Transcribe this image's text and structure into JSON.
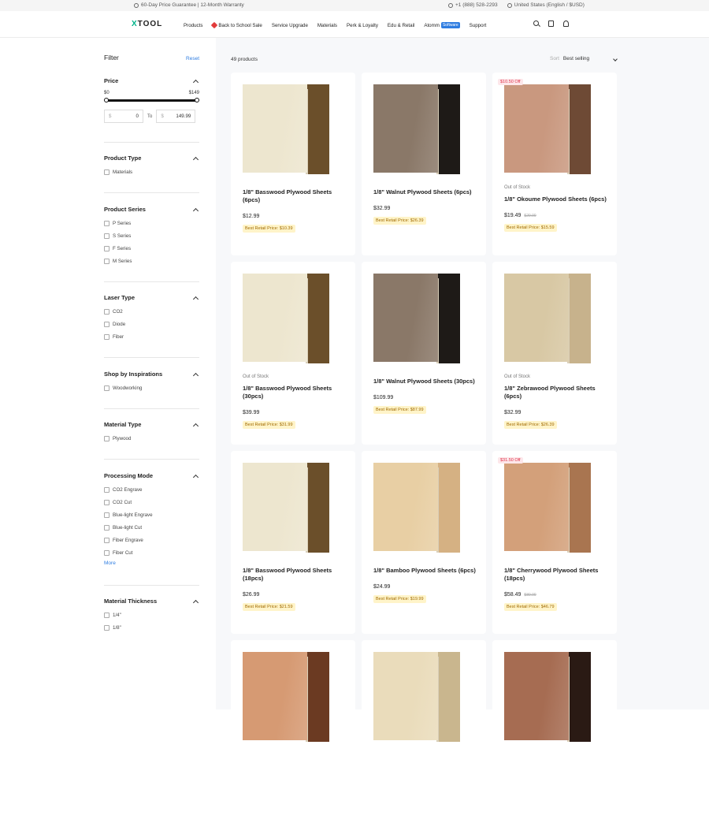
{
  "topbar": {
    "promo": "60-Day Price Guarantee | 12-Month Warranty",
    "phone": "+1 (888) 528-2293",
    "region": "United States (English / $USD)"
  },
  "nav": {
    "logo_prefix": "X",
    "logo_rest": "TOOL",
    "items": [
      "Products",
      "Back to School Sale",
      "Service Upgrade",
      "Materials",
      "Perk & Loyalty",
      "Edu & Retail",
      "Atomm",
      "Support"
    ],
    "atomm_badge": "Software",
    "icons": [
      "search-icon",
      "bag-icon",
      "user-icon"
    ]
  },
  "filter": {
    "title": "Filter",
    "reset": "Reset",
    "price": {
      "title": "Price",
      "min_label": "$0",
      "max_label": "$149",
      "currency": "$",
      "from_value": "0",
      "to_label": "To",
      "to_value": "149.99"
    },
    "product_type": {
      "title": "Product Type",
      "options": [
        "Materials"
      ]
    },
    "product_series": {
      "title": "Product Series",
      "options": [
        "P Series",
        "S Series",
        "F Series",
        "M Series"
      ]
    },
    "laser_type": {
      "title": "Laser Type",
      "options": [
        "CO2",
        "Diode",
        "Fiber"
      ]
    },
    "inspirations": {
      "title": "Shop by Inspirations",
      "options": [
        "Woodworking"
      ]
    },
    "material_type": {
      "title": "Material Type",
      "options": [
        "Plywood"
      ]
    },
    "processing_mode": {
      "title": "Processing Mode",
      "options": [
        "CO2 Engrave",
        "CO2 Cut",
        "Blue-light Engrave",
        "Blue-light Cut",
        "Fiber Engrave",
        "Fiber Cut"
      ],
      "more": "More"
    },
    "thickness": {
      "title": "Material Thickness",
      "options": [
        "1/4\"",
        "1/8\""
      ]
    }
  },
  "listing": {
    "count": "49 products",
    "sort_label": "Sort",
    "sort_value": "Best selling"
  },
  "products": [
    {
      "name": "1/8\" Basswood Plywood Sheets (6pcs)",
      "price": "$12.99",
      "old_price": "",
      "retail": "Best Retail Price: $10.39",
      "stock": "",
      "badge": "",
      "front": "#ede6cf",
      "back": "#6b4f2a"
    },
    {
      "name": "1/8\" Walnut Plywood Sheets (6pcs)",
      "price": "$32.99",
      "old_price": "",
      "retail": "Best Retail Price: $26.39",
      "stock": "",
      "badge": "",
      "front": "#8a7868",
      "back": "#1e1a17"
    },
    {
      "name": "1/8\" Okoume Plywood Sheets (6pcs)",
      "price": "$19.49",
      "old_price": "$29.99",
      "retail": "Best Retail Price: $15.59",
      "stock": "Out of Stock",
      "badge": "$10.50 Off",
      "front": "#c9987f",
      "back": "#6e4a35"
    },
    {
      "name": "1/8\" Basswood Plywood Sheets (30pcs)",
      "price": "$39.99",
      "old_price": "",
      "retail": "Best Retail Price: $31.99",
      "stock": "Out of Stock",
      "badge": "",
      "front": "#ede6cf",
      "back": "#6b4f2a"
    },
    {
      "name": "1/8\" Walnut Plywood Sheets (30pcs)",
      "price": "$109.99",
      "old_price": "",
      "retail": "Best Retail Price: $87.99",
      "stock": "",
      "badge": "",
      "front": "#8a7868",
      "back": "#1e1a17"
    },
    {
      "name": "1/8\" Zebrawood Plywood Sheets (6pcs)",
      "price": "$32.99",
      "old_price": "",
      "retail": "Best Retail Price: $26.39",
      "stock": "Out of Stock",
      "badge": "",
      "front": "#d8c8a4",
      "back": "#c7b28c"
    },
    {
      "name": "1/8\" Basswood Plywood Sheets (18pcs)",
      "price": "$26.99",
      "old_price": "",
      "retail": "Best Retail Price: $21.59",
      "stock": "",
      "badge": "",
      "front": "#ede6cf",
      "back": "#6b4f2a"
    },
    {
      "name": "1/8\" Bamboo Plywood Sheets (6pcs)",
      "price": "$24.99",
      "old_price": "",
      "retail": "Best Retail Price: $19.99",
      "stock": "",
      "badge": "",
      "front": "#e8cfa4",
      "back": "#d5b183"
    },
    {
      "name": "1/8\" Cherrywood Plywood Sheets (18pcs)",
      "price": "$58.49",
      "old_price": "$89.99",
      "retail": "Best Retail Price: $46.79",
      "stock": "",
      "badge": "$31.50 Off",
      "front": "#d3a07a",
      "back": "#a97550"
    },
    {
      "name": "",
      "price": "",
      "old_price": "",
      "retail": "",
      "stock": "",
      "badge": "",
      "front": "#d69a73",
      "back": "#6b3a22"
    },
    {
      "name": "",
      "price": "",
      "old_price": "",
      "retail": "",
      "stock": "",
      "badge": "",
      "front": "#eadcbb",
      "back": "#c9b68e"
    },
    {
      "name": "",
      "price": "",
      "old_price": "",
      "retail": "",
      "stock": "",
      "badge": "",
      "front": "#a66c52",
      "back": "#2a1a14"
    }
  ],
  "colors": {
    "accent": "#2f7de1",
    "brand": "#00b389",
    "sale": "#e0364d",
    "retail_bg": "#fff4c9"
  }
}
